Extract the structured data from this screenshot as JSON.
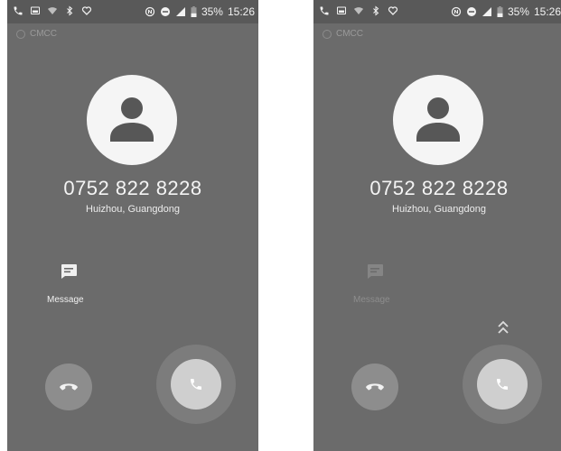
{
  "screens": [
    {
      "status": {
        "battery": "35%",
        "time": "15:26"
      },
      "carrier": "CMCC",
      "caller": {
        "number": "0752 822 8228",
        "location": "Huizhou, Guangdong"
      },
      "message_label": "Message",
      "icons": [
        "phone-icon",
        "image-icon",
        "wifi-icon",
        "bluetooth-icon",
        "heart-icon",
        "nfc-icon",
        "dnd-icon",
        "signal-icon",
        "battery-icon",
        "person-icon",
        "message-icon",
        "hangup-icon",
        "answer-icon"
      ]
    },
    {
      "status": {
        "battery": "35%",
        "time": "15:26"
      },
      "carrier": "CMCC",
      "caller": {
        "number": "0752 822 8228",
        "location": "Huizhou, Guangdong"
      },
      "message_label": "Message",
      "icons": [
        "phone-icon",
        "image-icon",
        "wifi-icon",
        "bluetooth-icon",
        "heart-icon",
        "nfc-icon",
        "dnd-icon",
        "signal-icon",
        "battery-icon",
        "person-icon",
        "message-icon",
        "hangup-icon",
        "answer-icon",
        "swipe-up-icon"
      ]
    }
  ],
  "colors": {
    "background": "#6b6b6b",
    "statusbar": "#595959",
    "avatar": "#f5f5f5",
    "text": "#f4f4f4",
    "answer": "#cfcfcf",
    "decline": "#8d8d8d"
  }
}
